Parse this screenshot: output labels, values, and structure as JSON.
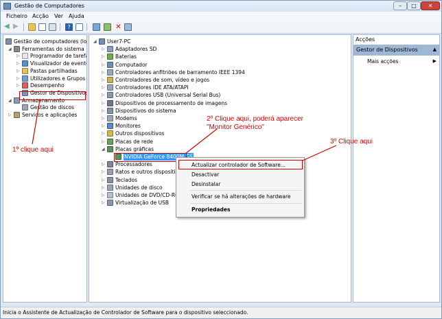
{
  "window": {
    "title": "Gestão de Computadores"
  },
  "menu": [
    "Ficheiro",
    "Acção",
    "Ver",
    "Ajuda"
  ],
  "left_tree": [
    {
      "label": "Gestão de computadores (loca",
      "indent": 0,
      "arrow": "",
      "icon": "computer-management-icon"
    },
    {
      "label": "Ferramentas do sistema",
      "indent": 1,
      "arrow": "◢",
      "icon": "tools-icon"
    },
    {
      "label": "Programador de tarefas",
      "indent": 2,
      "arrow": "▷",
      "icon": "clock-icon"
    },
    {
      "label": "Visualizador de eventos",
      "indent": 2,
      "arrow": "▷",
      "icon": "event-viewer-icon"
    },
    {
      "label": "Pastas partilhadas",
      "indent": 2,
      "arrow": "▷",
      "icon": "shared-folder-icon"
    },
    {
      "label": "Utilizadores e Grupos Lo",
      "indent": 2,
      "arrow": "▷",
      "icon": "users-icon"
    },
    {
      "label": "Desempenho",
      "indent": 2,
      "arrow": "▷",
      "icon": "performance-icon"
    },
    {
      "label": "Gestor de Dispositivos",
      "indent": 2,
      "arrow": "",
      "icon": "device-manager-icon"
    },
    {
      "label": "Armazenamento",
      "indent": 1,
      "arrow": "◢",
      "icon": "storage-icon"
    },
    {
      "label": "Gestão de discos",
      "indent": 2,
      "arrow": "",
      "icon": "disk-icon"
    },
    {
      "label": "Serviços e aplicações",
      "indent": 1,
      "arrow": "▷",
      "icon": "services-icon"
    }
  ],
  "device_tree": [
    {
      "label": "User7-PC",
      "indent": 0,
      "arrow": "◢",
      "icon": "computer-icon"
    },
    {
      "label": "Adaptadores SD",
      "indent": 1,
      "arrow": "▷",
      "icon": "sd-adapter-icon"
    },
    {
      "label": "Baterias",
      "indent": 1,
      "arrow": "▷",
      "icon": "battery-icon"
    },
    {
      "label": "Computador",
      "indent": 1,
      "arrow": "▷",
      "icon": "computer-icon"
    },
    {
      "label": "Controladores anfitriões de barramento IEEE 1394",
      "indent": 1,
      "arrow": "▷",
      "icon": "controller-icon"
    },
    {
      "label": "Controladores de som, vídeo e jogos",
      "indent": 1,
      "arrow": "▷",
      "icon": "sound-icon"
    },
    {
      "label": "Controladores IDE ATA/ATAPI",
      "indent": 1,
      "arrow": "▷",
      "icon": "ide-icon"
    },
    {
      "label": "Controladores USB (Universal Serial Bus)",
      "indent": 1,
      "arrow": "▷",
      "icon": "usb-icon"
    },
    {
      "label": "Dispositivos de processamento de imagens",
      "indent": 1,
      "arrow": "▷",
      "icon": "camera-icon"
    },
    {
      "label": "Dispositivos do sistema",
      "indent": 1,
      "arrow": "▷",
      "icon": "system-device-icon"
    },
    {
      "label": "Modems",
      "indent": 1,
      "arrow": "▷",
      "icon": "modem-icon"
    },
    {
      "label": "Monitores",
      "indent": 1,
      "arrow": "▷",
      "icon": "monitor-icon"
    },
    {
      "label": "Outros dispositivos",
      "indent": 1,
      "arrow": "▷",
      "icon": "unknown-device-icon"
    },
    {
      "label": "Placas de rede",
      "indent": 1,
      "arrow": "▷",
      "icon": "network-card-icon"
    },
    {
      "label": "Placas gráficas",
      "indent": 1,
      "arrow": "◢",
      "icon": "display-adapter-icon"
    },
    {
      "label": "NVIDIA GeForce 8400M GS",
      "indent": 2,
      "arrow": "",
      "icon": "display-adapter-icon"
    },
    {
      "label": "Processadores",
      "indent": 1,
      "arrow": "▷",
      "icon": "processor-icon"
    },
    {
      "label": "Ratos e outros dispositivos",
      "indent": 1,
      "arrow": "▷",
      "icon": "mouse-icon"
    },
    {
      "label": "Teclados",
      "indent": 1,
      "arrow": "▷",
      "icon": "keyboard-icon"
    },
    {
      "label": "Unidades de disco",
      "indent": 1,
      "arrow": "▷",
      "icon": "disk-icon"
    },
    {
      "label": "Unidades de DVD/CD-ROM",
      "indent": 1,
      "arrow": "▷",
      "icon": "dvd-icon"
    },
    {
      "label": "Virtualização de USB",
      "indent": 1,
      "arrow": "▷",
      "icon": "usb-icon"
    }
  ],
  "actions": {
    "header": "Acções",
    "selected": "Gestor de Dispositivos",
    "more": "Mais acções"
  },
  "context_menu": {
    "update_driver": "Actualizar controlador de Software...",
    "disable": "Desactivar",
    "uninstall": "Desinstalar",
    "scan": "Verificar se há alterações de hardware",
    "properties": "Propriedades"
  },
  "annotations": {
    "step1": "1º clique aqui",
    "step2_line1": "2º Clique aqui, poderá aparecer",
    "step2_line2": "\"Monitor Genérico\"",
    "step3": "3º Clique aqui"
  },
  "status": "Inicia o Assistente de Actualização de Controlador de Software para o dispositivo seleccionado.",
  "colors": {
    "accent": "#d40000",
    "selection": "#9fb7d6"
  }
}
